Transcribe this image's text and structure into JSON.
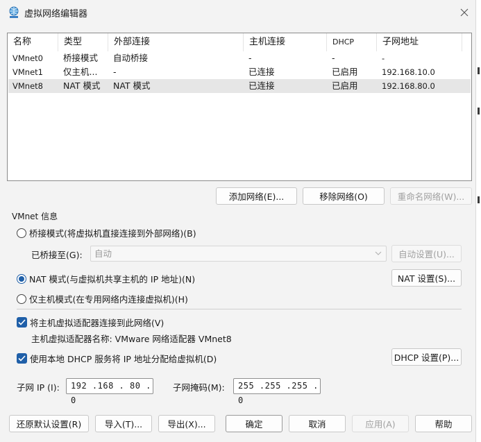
{
  "window": {
    "title": "虚拟网络编辑器"
  },
  "table": {
    "headers": [
      "名称",
      "类型",
      "外部连接",
      "主机连接",
      "DHCP",
      "子网地址"
    ],
    "rows": [
      {
        "name": "VMnet0",
        "type": "桥接模式",
        "external": "自动桥接",
        "host": "-",
        "dhcp": "-",
        "subnet": "-"
      },
      {
        "name": "VMnet1",
        "type": "仅主机...",
        "external": "-",
        "host": "已连接",
        "dhcp": "已启用",
        "subnet": "192.168.10.0"
      },
      {
        "name": "VMnet8",
        "type": "NAT 模式",
        "external": "NAT 模式",
        "host": "已连接",
        "dhcp": "已启用",
        "subnet": "192.168.80.0"
      }
    ],
    "selected_row": 2
  },
  "table_buttons": {
    "add": "添加网络(E)...",
    "remove": "移除网络(O)",
    "rename": "重命名网络(W)..."
  },
  "vmnet_info": {
    "group_label": "VMnet 信息",
    "bridged_label": "桥接模式(将虚拟机直接连接到外部网络)(B)",
    "bridged_to_label": "已桥接至(G):",
    "bridged_to_value": "自动",
    "auto_settings": "自动设置(U)...",
    "nat_label": "NAT 模式(与虚拟机共享主机的 IP 地址)(N)",
    "nat_settings": "NAT 设置(S)...",
    "host_only_label": "仅主机模式(在专用网络内连接虚拟机)(H)",
    "selected_mode": "nat",
    "connect_adapter_label": "将主机虚拟适配器连接到此网络(V)",
    "connect_adapter_checked": true,
    "adapter_name_text": "主机虚拟适配器名称: VMware 网络适配器 VMnet8",
    "use_dhcp_label": "使用本地 DHCP 服务将 IP 地址分配给虚拟机(D)",
    "use_dhcp_checked": true,
    "dhcp_settings": "DHCP 设置(P)...",
    "subnet_ip_label": "子网 IP (I):",
    "subnet_ip_value": "192 .168 . 80 . 0",
    "subnet_mask_label": "子网掩码(M):",
    "subnet_mask_value": "255 .255 .255 . 0"
  },
  "footer": {
    "restore": "还原默认设置(R)",
    "import": "导入(T)...",
    "export": "导出(X)...",
    "ok": "确定",
    "cancel": "取消",
    "apply": "应用(A)",
    "help": "帮助"
  },
  "colors": {
    "accent": "#1f5fa8",
    "dialog_bg": "#f3f3f3",
    "selected_row": "#e6e6e6",
    "disabled_text": "#a0a0a0"
  }
}
